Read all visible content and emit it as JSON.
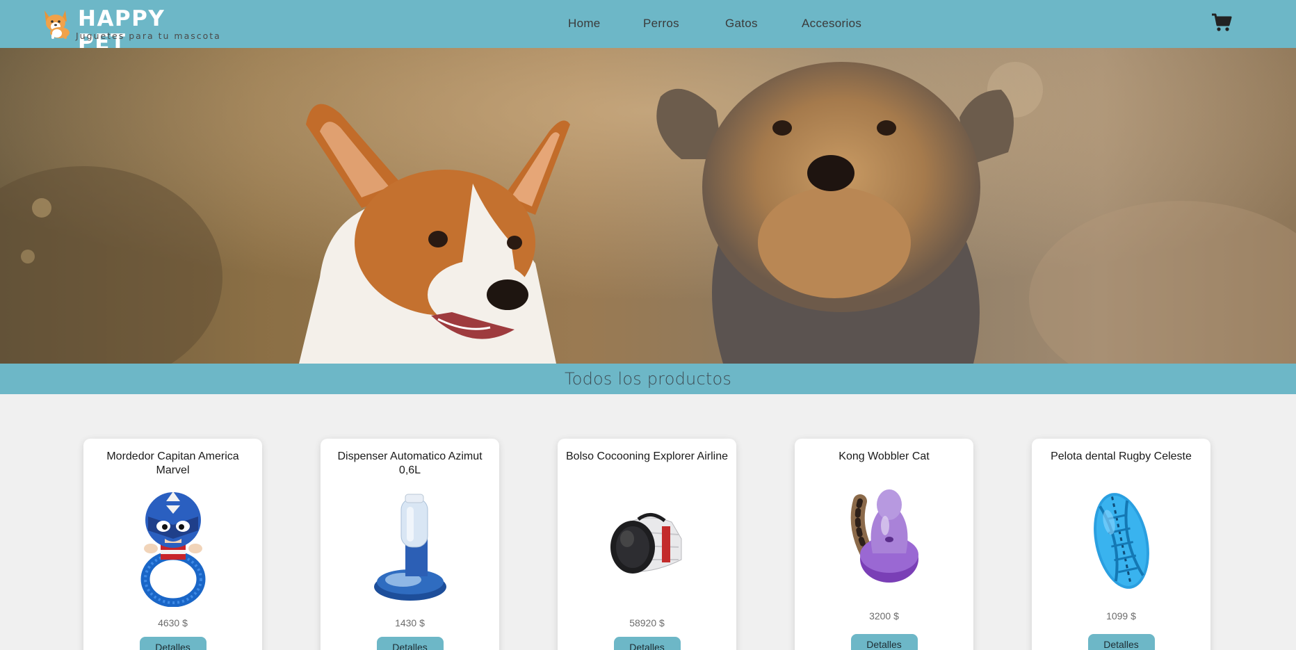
{
  "brand": {
    "name": "HAPPY PET",
    "tagline": "Juguetes para tu mascota"
  },
  "nav": {
    "items": [
      {
        "label": "Home"
      },
      {
        "label": "Perros"
      },
      {
        "label": "Gatos"
      },
      {
        "label": "Accesorios"
      }
    ],
    "cart_icon": "shopping-cart-icon"
  },
  "hero": {
    "image": "corgi-and-yorkshire-terrier-photo"
  },
  "section": {
    "title": "Todos los productos"
  },
  "products": [
    {
      "title": "Mordedor Capitan America Marvel",
      "price": "4630 $",
      "button": "Detalles",
      "image": "captain-america-plush-toy"
    },
    {
      "title": "Dispenser Automatico Azimut 0,6L",
      "price": "1430 $",
      "button": "Detalles",
      "image": "water-dispenser"
    },
    {
      "title": "Bolso Cocooning Explorer Airline",
      "price": "58920 $",
      "button": "Detalles",
      "image": "pet-carrier-bag"
    },
    {
      "title": "Kong Wobbler Cat",
      "price": "3200 $",
      "button": "Detalles",
      "image": "purple-wobbler-toy"
    },
    {
      "title": "Pelota dental Rugby Celeste",
      "price": "1099 $",
      "button": "Detalles",
      "image": "blue-rugby-dental-ball"
    }
  ],
  "colors": {
    "primary": "#6db7c7",
    "background": "#f0f0f0",
    "card": "#ffffff"
  }
}
